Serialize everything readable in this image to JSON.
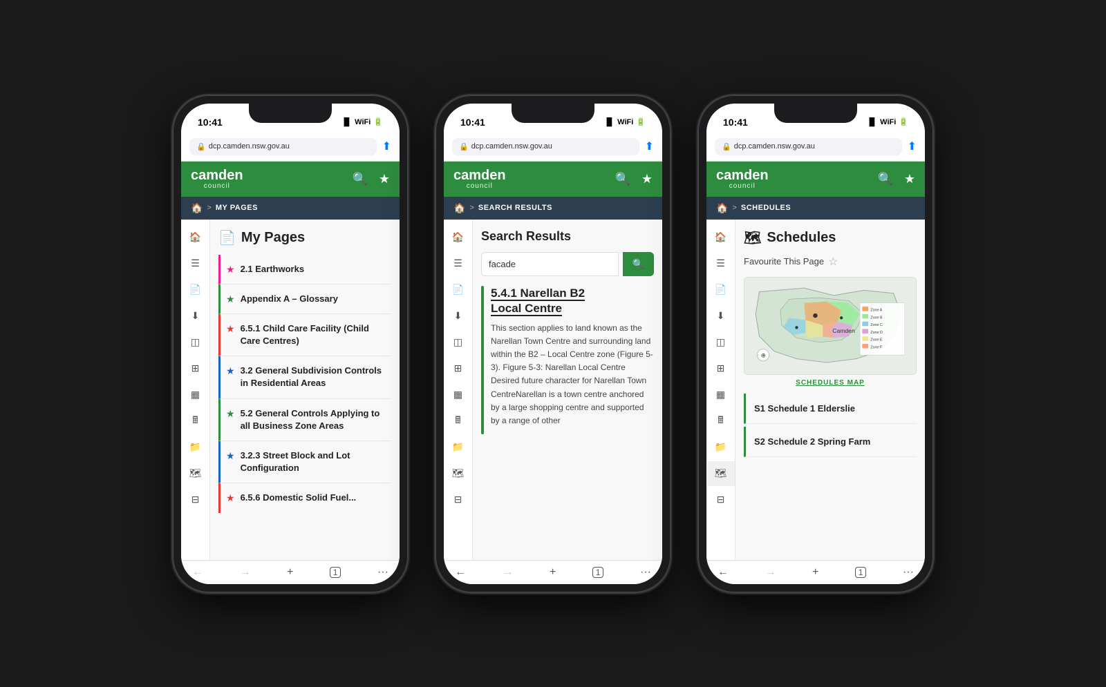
{
  "phones": [
    {
      "id": "my-pages",
      "time": "10:41",
      "url": "dcp.camden.nsw.gov.au",
      "breadcrumb_home": "HOME",
      "breadcrumb_sep": ">",
      "breadcrumb_current": "MY PAGES",
      "page_title": "My Pages",
      "page_title_icon": "📄",
      "items": [
        {
          "label": "2.1 Earthworks",
          "star_color": "#e91e8c",
          "accent_color": "#e91e8c"
        },
        {
          "label": "Appendix A – Glossary",
          "star_color": "#2d8c3e",
          "accent_color": "#2d8c3e"
        },
        {
          "label": "6.5.1 Child Care Facility (Child Care Centres)",
          "star_color": "#e53935",
          "accent_color": "#e53935"
        },
        {
          "label": "3.2 General Subdivision Controls in Residential Areas",
          "star_color": "#1565c0",
          "accent_color": "#1565c0"
        },
        {
          "label": "5.2 General Controls Applying to all Business Zone Areas",
          "star_color": "#2d8c3e",
          "accent_color": "#2d8c3e"
        },
        {
          "label": "3.2.3 Street Block and Lot Configuration",
          "star_color": "#1565c0",
          "accent_color": "#1565c0"
        },
        {
          "label": "6.5.6 Domestic Solid Fuel...",
          "star_color": "#e53935",
          "accent_color": "#e53935"
        }
      ]
    },
    {
      "id": "search-results",
      "time": "10:41",
      "url": "dcp.camden.nsw.gov.au",
      "breadcrumb_home": "HOME",
      "breadcrumb_sep": ">",
      "breadcrumb_current": "SEARCH RESULTS",
      "page_title": "Search Results",
      "search_value": "facade",
      "search_placeholder": "facade",
      "result_title_line1": "5.4.1 Narellan B2",
      "result_title_line2": "Local Centre",
      "result_body": "This section applies to land known as the Narellan Town Centre and surrounding land within the B2 – Local Centre zone (Figure 5-3). Figure 5-3: Narellan Local Centre Desired future character for Narellan Town CentreNarellan is a town centre anchored by a large shopping centre and supported by a range of other"
    },
    {
      "id": "schedules",
      "time": "10:41",
      "url": "dcp.camden.nsw.gov.au",
      "breadcrumb_home": "HOME",
      "breadcrumb_sep": ">",
      "breadcrumb_current": "SCHEDULES",
      "page_title": "Schedules",
      "page_title_icon": "🗺",
      "favourite_label": "Favourite This Page",
      "map_link_label": "SCHEDULES MAP",
      "schedules": [
        {
          "id": "S1",
          "label": "S1 Schedule 1 Elderslie"
        },
        {
          "id": "S2",
          "label": "S2 Schedule 2 Spring Farm"
        }
      ]
    }
  ],
  "browser": {
    "back": "←",
    "forward": "→",
    "add": "+",
    "tabs": "1",
    "more": "···"
  },
  "header": {
    "logo_camden": "camden",
    "logo_council": "council",
    "search_icon": "🔍",
    "star_icon": "★"
  }
}
